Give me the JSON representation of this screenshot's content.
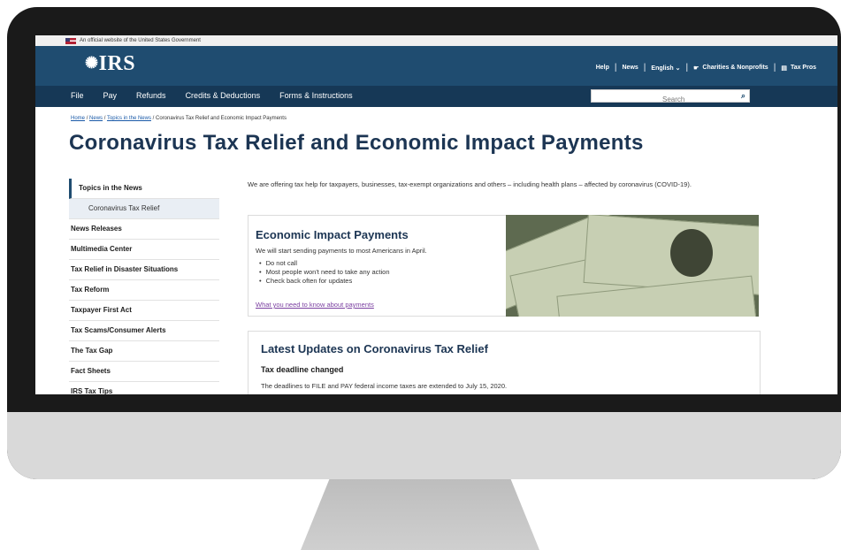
{
  "banner": {
    "text": "An official website of the United States Government"
  },
  "header": {
    "logo": "IRS",
    "links": [
      "Help",
      "News",
      "English",
      "Charities & Nonprofits",
      "Tax Pros"
    ]
  },
  "nav": {
    "items": [
      "File",
      "Pay",
      "Refunds",
      "Credits & Deductions",
      "Forms & Instructions"
    ],
    "search_placeholder": "Search"
  },
  "breadcrumb": [
    "Home",
    "News",
    "Topics in the News",
    "Coronavirus Tax Relief and Economic Impact Payments"
  ],
  "page": {
    "title": "Coronavirus Tax Relief and Economic Impact Payments"
  },
  "sidebar": {
    "items": [
      "Topics in the News",
      "Coronavirus Tax Relief",
      "News Releases",
      "Multimedia Center",
      "Tax Relief in Disaster Situations",
      "Tax Reform",
      "Taxpayer First Act",
      "Tax Scams/Consumer Alerts",
      "The Tax Gap",
      "Fact Sheets",
      "IRS Tax Tips"
    ]
  },
  "intro": {
    "text": "We are offering tax help for taxpayers, businesses, tax-exempt organizations and others – including health plans – affected by coronavirus (COVID-19)."
  },
  "eip": {
    "heading": "Economic Impact Payments",
    "desc": "We will start sending payments to most Americans in April.",
    "bullets": [
      "Do not call",
      "Most people won't need to take any action",
      "Check back often for updates"
    ],
    "link": "What you need to know about payments"
  },
  "updates": {
    "heading": "Latest Updates on Coronavirus Tax Relief",
    "sub": "Tax deadline changed",
    "text": "The deadlines to FILE and PAY federal income taxes are extended to July 15, 2020."
  }
}
